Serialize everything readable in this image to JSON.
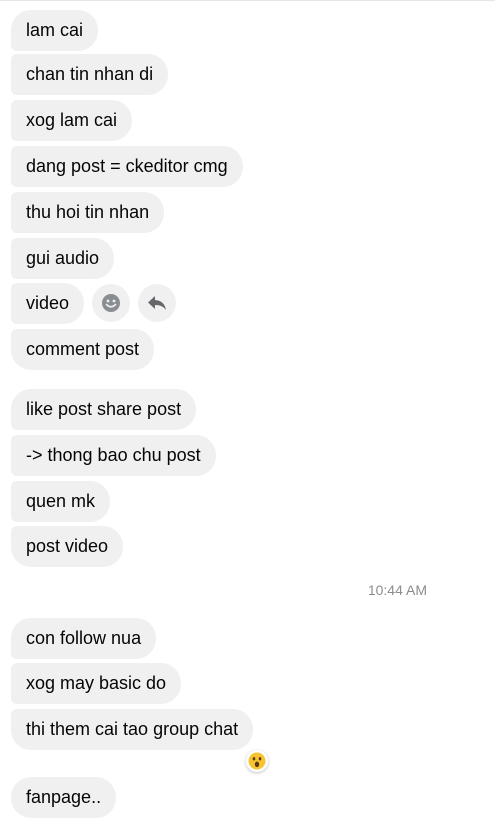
{
  "messages": [
    {
      "text": "lam cai"
    },
    {
      "text": "chan tin nhan di"
    },
    {
      "text": "xog lam cai"
    },
    {
      "text": "dang post = ckeditor cmg"
    },
    {
      "text": "thu hoi tin nhan"
    },
    {
      "text": "gui audio"
    },
    {
      "text": "video"
    },
    {
      "text": "comment post"
    },
    {
      "text": "like post share post"
    },
    {
      "text": "-> thong bao chu post"
    },
    {
      "text": "quen mk"
    },
    {
      "text": "post video"
    },
    {
      "text": "con follow nua"
    },
    {
      "text": "xog may basic do"
    },
    {
      "text": "thi them cai tao group chat"
    },
    {
      "text": "fanpage.."
    }
  ],
  "timestamp": "10:44 AM",
  "hover_actions": {
    "react_icon": "smiley-icon",
    "reply_icon": "reply-arrow-icon"
  },
  "reaction": {
    "icon": "surprised-face-icon",
    "on_message": "thi them cai tao group chat"
  },
  "colors": {
    "bubble_bg": "#f0f0f0",
    "text": "#050505",
    "timestamp": "#8a8d91",
    "icon": "#65676b"
  }
}
